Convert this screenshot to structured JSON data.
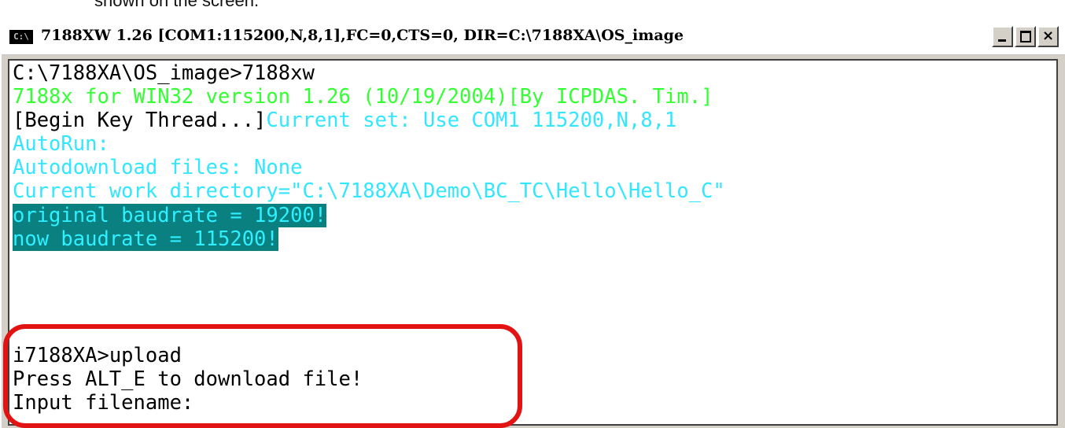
{
  "caption_fragment": "shown on the screen.",
  "window": {
    "icon_label": "C:\\",
    "title": "7188XW 1.26 [COM1:115200,N,8,1],FC=0,CTS=0, DIR=C:\\7188XA\\OS_image",
    "controls": {
      "minimize": "minimize-icon",
      "maximize": "maximize-icon",
      "close": "×"
    }
  },
  "console": {
    "line1": "C:\\7188XA\\OS_image>7188xw",
    "line2": "7188x for WIN32 version 1.26 (10/19/2004)[By ICPDAS. Tim.]",
    "line3_prefix": "[Begin Key Thread...]",
    "line3_suffix": "Current set: Use COM1 115200,N,8,1",
    "line4": "AutoRun:",
    "line5": "Autodownload files: None",
    "line6": "Current work directory=\"C:\\7188XA\\Demo\\BC_TC\\Hello\\Hello_C\"",
    "line7": "original baudrate = 19200!",
    "line8": "now baudrate = 115200!",
    "line9": "i7188XA>upload",
    "line10": "Press ALT_E to download file!",
    "line11": "Input filename:"
  },
  "colors": {
    "prompt_text": "#000000",
    "version_text": "#33ff33",
    "status_text": "#33e6ff",
    "highlight_bg": "#0a8080",
    "annotation_ring": "#e21313"
  }
}
